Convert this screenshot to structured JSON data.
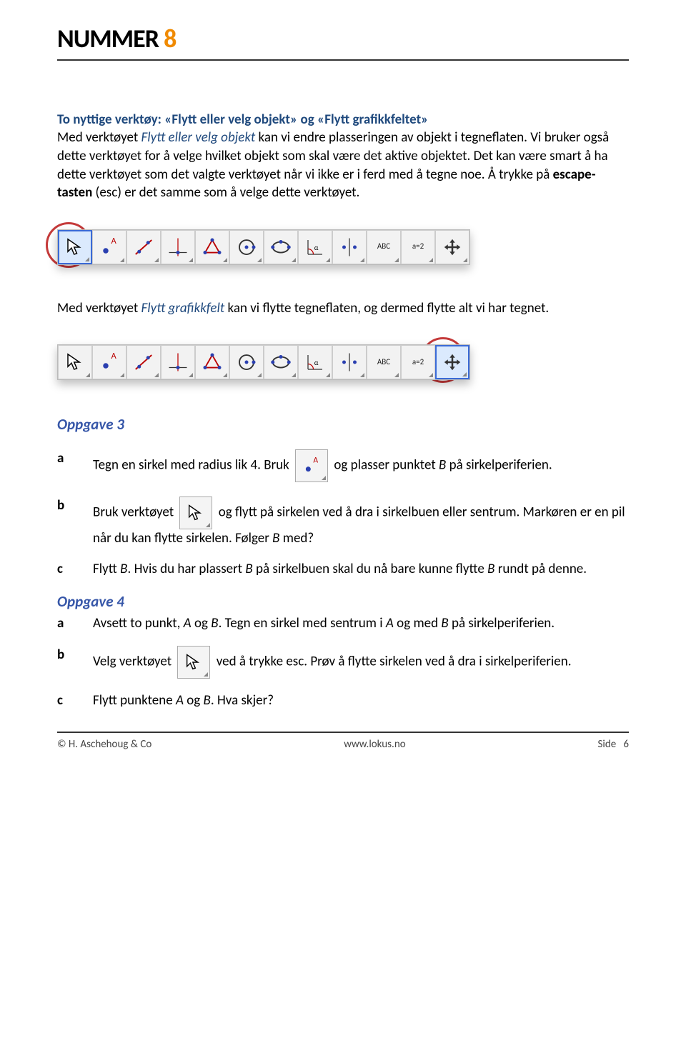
{
  "header": {
    "brand_left": "NUMMER",
    "brand_right": "8"
  },
  "intro": {
    "heading_prefix": "To nyttige verktøy: «Flytt eller velg objekt» og «Flytt grafikkfeltet»",
    "p1_a": "Med verktøyet ",
    "p1_tool1": "Flytt eller velg objekt",
    "p1_b": " kan vi endre plasseringen av objekt i tegneflaten. Vi bruker også dette verktøyet for å velge hvilket objekt som skal være det aktive objektet. Det kan være smart å ha dette verktøyet som det valgte verktøyet når vi ikke er i ferd med å tegne noe. Å trykke på ",
    "p1_bold": "escape-tasten",
    "p1_c": " (esc) er det samme som å velge dette verktøyet."
  },
  "mid": {
    "p2_a": "Med verktøyet ",
    "p2_tool": "Flytt grafikkfelt",
    "p2_b": " kan vi flytte tegneflaten, og dermed flytte alt vi har tegnet."
  },
  "toolbar_labels": {
    "abc": "ABC",
    "a2": "a=2"
  },
  "oppgave3": {
    "title": "Oppgave 3",
    "a": {
      "label": "a",
      "t1": "Tegn en sirkel med radius lik 4. Bruk ",
      "t2": " og plasser punktet ",
      "i1": "B",
      "t3": " på sirkelperiferien."
    },
    "b": {
      "label": "b",
      "t1": "Bruk verktøyet ",
      "t2": " og flytt på sirkelen ved å dra i sirkelbuen eller sentrum. Markøren er en pil når du kan flytte sirkelen. Følger ",
      "i1": "B",
      "t3": " med?"
    },
    "c": {
      "label": "c",
      "t1": "Flytt ",
      "i1": "B",
      "t2": ". Hvis du har plassert ",
      "i2": "B",
      "t3": " på sirkelbuen skal du nå bare kunne flytte ",
      "i3": "B",
      "t4": " rundt på denne."
    }
  },
  "oppgave4": {
    "title": "Oppgave 4",
    "a": {
      "label": "a",
      "t1": "Avsett to punkt, ",
      "i1": "A",
      "t2": " og ",
      "i2": "B",
      "t3": ". Tegn en sirkel med sentrum i ",
      "i3": "A",
      "t4": " og med ",
      "i4": "B",
      "t5": " på sirkelperiferien."
    },
    "b": {
      "label": "b",
      "t1": "Velg verktøyet ",
      "t2": " ved å trykke esc. Prøv å flytte sirkelen ved å dra i sirkelperiferien."
    },
    "c": {
      "label": "c",
      "t1": "Flytt punktene ",
      "i1": "A",
      "t2": " og ",
      "i2": "B",
      "t3": ". Hva skjer?"
    }
  },
  "footer": {
    "left": "© H. Aschehoug & Co",
    "center": "www.lokus.no",
    "right_label": "Side",
    "page": "6"
  }
}
